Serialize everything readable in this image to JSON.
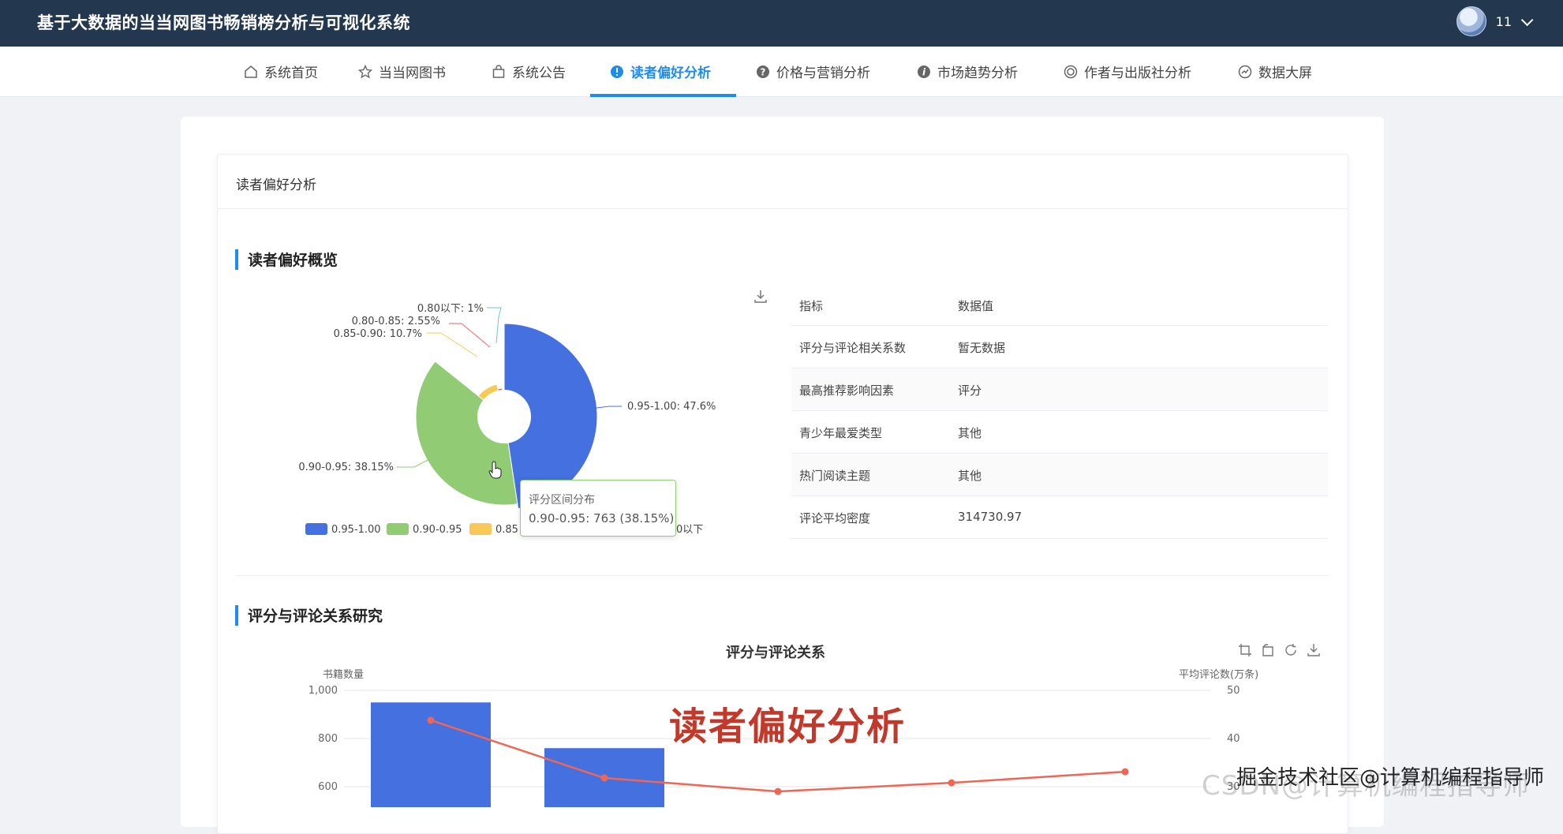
{
  "header": {
    "app_title": "基于大数据的当当网图书畅销榜分析与可视化系统",
    "username": "11"
  },
  "nav": {
    "items": [
      {
        "label": "系统首页",
        "icon": "home-icon"
      },
      {
        "label": "当当网图书",
        "icon": "star-icon"
      },
      {
        "label": "系统公告",
        "icon": "bag-icon"
      },
      {
        "label": "读者偏好分析",
        "icon": "info-icon",
        "active": true
      },
      {
        "label": "价格与营销分析",
        "icon": "question-icon"
      },
      {
        "label": "市场趋势分析",
        "icon": "info-icon"
      },
      {
        "label": "作者与出版社分析",
        "icon": "target-icon"
      },
      {
        "label": "数据大屏",
        "icon": "dashboard-icon"
      }
    ]
  },
  "card": {
    "title": "读者偏好分析"
  },
  "overview": {
    "section_title": "读者偏好概览",
    "pie_labels": {
      "a": "0.80以下: 1%",
      "b": "0.80-0.85: 2.55%",
      "c": "0.85-0.90: 10.7%",
      "d": "0.95-1.00: 47.6%",
      "e": "0.90-0.95: 38.15%"
    },
    "legend": [
      "0.95-1.00",
      "0.90-0.95",
      "0.85",
      "0以下"
    ],
    "tooltip": {
      "title": "评分区间分布",
      "value": "0.90-0.95: 763 (38.15%)"
    },
    "table": {
      "headers": [
        "指标",
        "数据值"
      ],
      "rows": [
        [
          "评分与评论相关系数",
          "暂无数据"
        ],
        [
          "最高推荐影响因素",
          "评分"
        ],
        [
          "青少年最爱类型",
          "其他"
        ],
        [
          "热门阅读主题",
          "其他"
        ],
        [
          "评论平均密度",
          "314730.97"
        ]
      ]
    }
  },
  "relation": {
    "section_title": "评分与评论关系研究",
    "chart_title": "评分与评论关系",
    "left_axis_title": "书籍数量",
    "right_axis_title": "平均评论数(万条)",
    "left_ticks": [
      "1,000",
      "800",
      "600"
    ],
    "right_ticks": [
      "50",
      "40",
      "30"
    ]
  },
  "watermarks": {
    "big": "读者偏好分析",
    "corner": "掘金技术社区@计算机编程指导师",
    "ghost": "CSDN@计算机编程指导师"
  },
  "colors": {
    "accent": "#1f8ceb",
    "header_bg": "#23384f",
    "pie_blue": "#4470e0",
    "pie_green": "#91cc75",
    "pie_yellow": "#fac858",
    "line_red": "#ee6655"
  },
  "chart_data": [
    {
      "type": "pie",
      "title": "",
      "categories": [
        "0.95-1.00",
        "0.90-0.95",
        "0.85-0.90",
        "0.80-0.85",
        "0.80以下"
      ],
      "values": [
        47.6,
        38.15,
        10.7,
        2.55,
        1
      ],
      "tooltip_count_0.90-0.95": 763
    },
    {
      "type": "bar",
      "title": "评分与评论关系",
      "ylabel": "书籍数量",
      "y2label": "平均评论数(万条)",
      "ylim_visible": [
        600,
        1000
      ],
      "y2lim_visible": [
        30,
        50
      ],
      "series": [
        {
          "type": "bar",
          "values": [
            950,
            760
          ]
        },
        {
          "type": "line",
          "values": [
            43.8,
            31.8,
            29.0,
            30.8,
            33.1
          ]
        }
      ]
    }
  ]
}
